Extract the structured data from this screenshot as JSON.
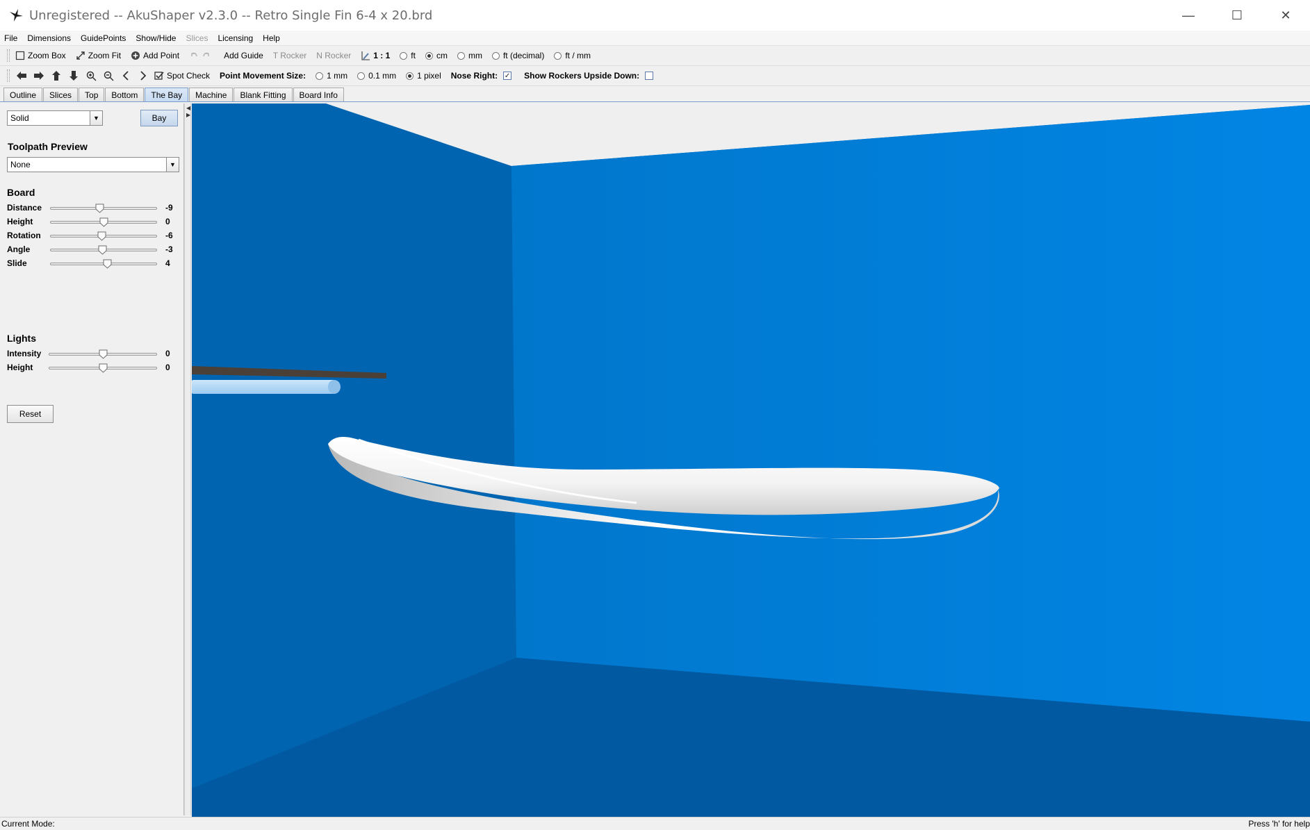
{
  "window": {
    "title": "Unregistered -- AkuShaper v2.3.0  --  Retro Single Fin 6-4 x 20.brd",
    "minimize": "—",
    "maximize": "☐",
    "close": "✕"
  },
  "menu": [
    {
      "label": "File",
      "disabled": false
    },
    {
      "label": "Dimensions",
      "disabled": false
    },
    {
      "label": "GuidePoints",
      "disabled": false
    },
    {
      "label": "Show/Hide",
      "disabled": false
    },
    {
      "label": "Slices",
      "disabled": true
    },
    {
      "label": "Licensing",
      "disabled": false
    },
    {
      "label": "Help",
      "disabled": false
    }
  ],
  "toolbar1": {
    "zoom_box": "Zoom Box",
    "zoom_fit": "Zoom Fit",
    "add_point": "Add Point",
    "add_guide": "Add Guide",
    "t_rocker": "T Rocker",
    "n_rocker": "N Rocker",
    "scale": "1 : 1",
    "units": [
      {
        "label": "ft",
        "selected": false
      },
      {
        "label": "cm",
        "selected": true
      },
      {
        "label": "mm",
        "selected": false
      },
      {
        "label": "ft (decimal)",
        "selected": false
      },
      {
        "label": "ft / mm",
        "selected": false
      }
    ]
  },
  "toolbar2": {
    "spot_check": "Spot Check",
    "point_movement_label": "Point Movement Size:",
    "movement_sizes": [
      {
        "label": "1 mm",
        "selected": false
      },
      {
        "label": "0.1 mm",
        "selected": false
      },
      {
        "label": "1 pixel",
        "selected": true
      }
    ],
    "nose_right_label": "Nose Right:",
    "nose_right_checked": true,
    "rockers_label": "Show Rockers Upside Down:",
    "rockers_checked": false
  },
  "tabs": [
    {
      "label": "Outline",
      "active": false
    },
    {
      "label": "Slices",
      "active": false
    },
    {
      "label": "Top",
      "active": false
    },
    {
      "label": "Bottom",
      "active": false
    },
    {
      "label": "The Bay",
      "active": true
    },
    {
      "label": "Machine",
      "active": false
    },
    {
      "label": "Blank Fitting",
      "active": false
    },
    {
      "label": "Board Info",
      "active": false
    }
  ],
  "panel": {
    "render_mode": "Solid",
    "bay_button": "Bay",
    "toolpath_title": "Toolpath Preview",
    "toolpath_value": "None",
    "board_title": "Board",
    "board_sliders": [
      {
        "label": "Distance",
        "value": "-9",
        "fraction": 0.46
      },
      {
        "label": "Height",
        "value": "0",
        "fraction": 0.5
      },
      {
        "label": "Rotation",
        "value": "-6",
        "fraction": 0.48
      },
      {
        "label": "Angle",
        "value": "-3",
        "fraction": 0.49
      },
      {
        "label": "Slide",
        "value": "4",
        "fraction": 0.53
      }
    ],
    "lights_title": "Lights",
    "light_sliders": [
      {
        "label": "Intensity",
        "value": "0",
        "fraction": 0.5
      },
      {
        "label": "Height",
        "value": "0",
        "fraction": 0.5
      }
    ],
    "reset_button": "Reset"
  },
  "status": {
    "mode": "Current Mode:",
    "help": "Press 'h' for help"
  },
  "colors": {
    "wall_back": "#0180dc",
    "wall_left": "#0164b0",
    "floor": "#0159a1",
    "ceiling": "#efefef",
    "board": "#f4f4f4"
  }
}
